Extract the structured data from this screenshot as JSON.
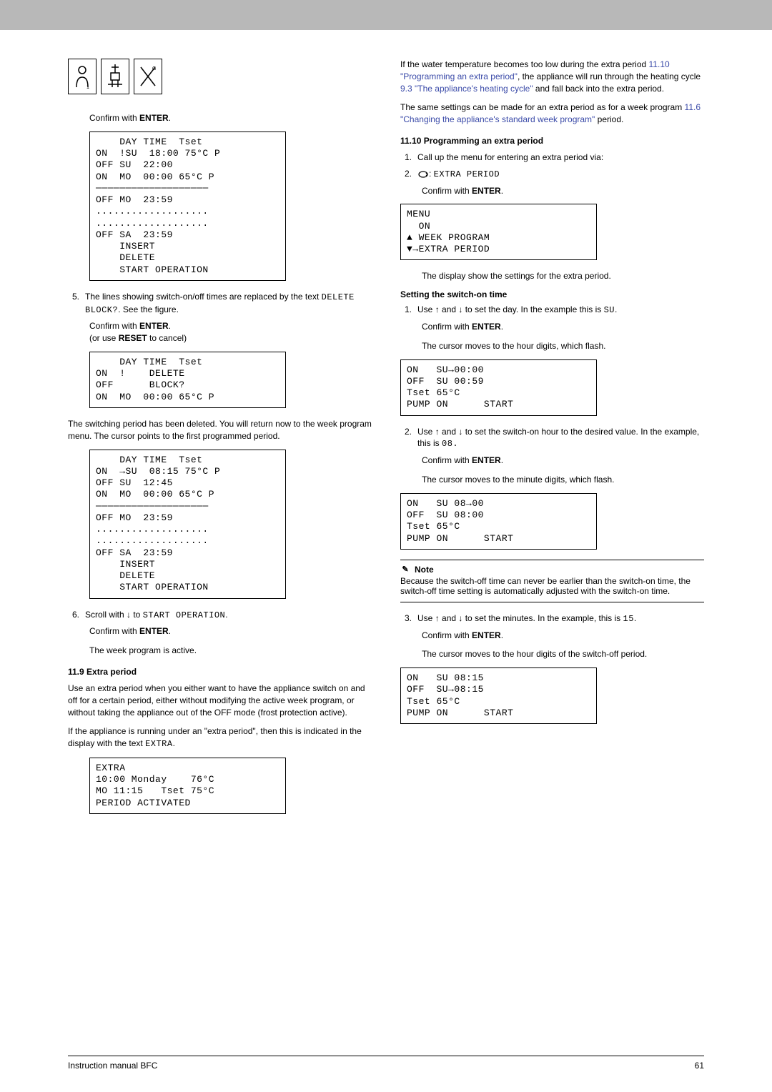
{
  "left": {
    "confirm1": "Confirm with",
    "enter": "ENTER",
    "box1": "    DAY TIME  Tset\nON  !SU  18:00 75°C P\nOFF SU  22:00\nON  MO  00:00 65°C P\n───────────────────\nOFF MO  23:59\n...................\n...................\nOFF SA  23:59\n    INSERT\n    DELETE\n    START OPERATION",
    "step5a": "The lines showing switch-on/off times are replaced by the text",
    "step5b": "DELETE BLOCK?",
    "step5c": ". See the figure.",
    "confirm2a": "Confirm with",
    "confirm2b": "(or use ",
    "reset": "RESET",
    "confirm2c": " to cancel)",
    "box2": "    DAY TIME  Tset\nON  !    DELETE\nOFF      BLOCK?\nON  MO  00:00 65°C P",
    "afterDel": "The switching period has been deleted. You will return now to the week program menu. The cursor points to the first programmed period.",
    "box3": "    DAY TIME  Tset\nON  →SU  08:15 75°C P\nOFF SU  12:45\nON  MO  00:00 65°C P\n───────────────────\nOFF MO  23:59\n...................\n...................\nOFF SA  23:59\n    INSERT\n    DELETE\n    START OPERATION",
    "step6a": "Scroll with ",
    "step6b": " to ",
    "step6c": "START OPERATION",
    "confirm3": "Confirm with",
    "weekActive": "The week program is active.",
    "h119": "11.9  Extra period",
    "p119a": "Use an extra period when you either want to have the appliance switch on and off for a certain period, either without modifying the active week program, or without taking the appliance out of the OFF mode (frost protection active).",
    "p119b": "If the appliance is running under an \"extra period\", then this is indicated in the display with the text ",
    "extraText": "EXTRA",
    "box4": "EXTRA\n10:00 Monday    76°C\nMO 11:15   Tset 75°C\nPERIOD ACTIVATED"
  },
  "right": {
    "p1a": "If the water temperature becomes too low during the extra period ",
    "link1": "11.10 \"Programming an extra period\"",
    "p1b": ", the appliance will run through the heating cycle ",
    "link2": "9.3 \"The appliance's heating cycle\"",
    "p1c": " and fall back into the extra period.",
    "p2a": "The same settings can be made for an extra period as for a week program ",
    "link3": "11.6 \"Changing the appliance's standard week program\"",
    "p2b": " period.",
    "h1110": "11.10 Programming an extra period",
    "step1": "Call up the menu for entering an extra period via:",
    "step2": "EXTRA PERIOD",
    "confirm1": "Confirm with",
    "box5": "MENU\n  ON\n▲ WEEK PROGRAM\n▼→EXTRA PERIOD",
    "dispShow": "The display show the settings for the extra period.",
    "setSwitch": "Setting the switch-on time",
    "s1a": "Use ",
    "s1b": " and ",
    "s1c": " to set the day. In the example this is ",
    "su": "SU",
    "confirmE": "Confirm with",
    "cursorHour": "The cursor moves to the hour digits, which flash.",
    "box6": "ON   SU→00:00\nOFF  SU 00:59\nTset 65°C\nPUMP ON      START",
    "s2a": "Use ",
    "s2b": " and ",
    "s2c": " to set the switch-on hour to the desired value. In the example, this is ",
    "v08": "08.",
    "cursorMin": "The cursor moves to the minute digits, which flash.",
    "box7": "ON   SU 08→00\nOFF  SU 08:00\nTset 65°C\nPUMP ON      START",
    "noteH": "Note",
    "noteBody": "Because the switch-off time can never be earlier than the switch-on time, the switch-off time setting is automatically adjusted with the switch-on time.",
    "s3a": "Use ",
    "s3b": " and ",
    "s3c": " to set the minutes. In the example, this is ",
    "v15": "15",
    "cursorOff": "The cursor moves to the hour digits of the switch-off period.",
    "box8": "ON   SU 08:15\nOFF  SU→08:15\nTset 65°C\nPUMP ON      START"
  },
  "footer": {
    "left": "Instruction manual BFC",
    "right": "61"
  }
}
